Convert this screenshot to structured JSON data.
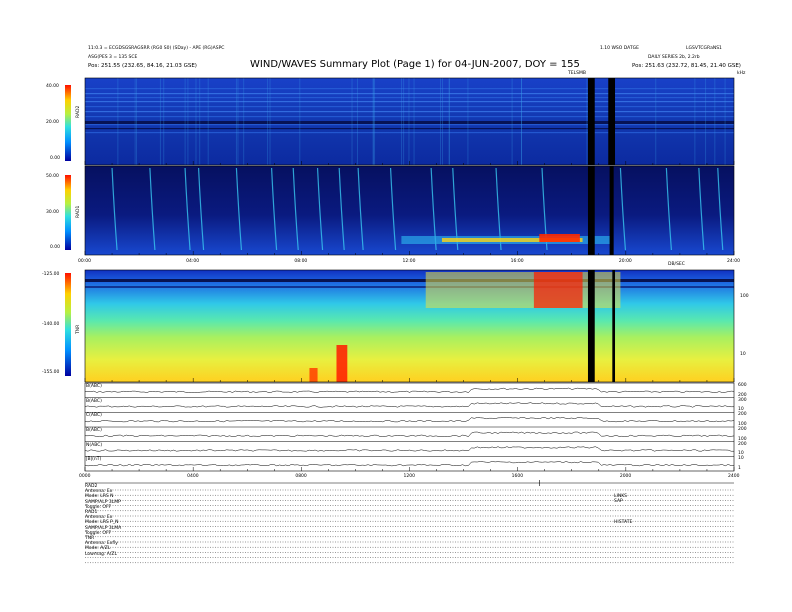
{
  "header": {
    "title": "WIND/WAVES Summary Plot (Page 1) for 04-JUN-2007, DOY = 155",
    "left_line1": "11:0.3 = ECGDSGSRAGSRR (RG0 S0) (SDay) - APE (RG)ASPC",
    "left_line2": "ASG(PES 3 = 135 SCE",
    "left_line3": "Pos:   251.55 (232.65, 84.16, 21.03 GSE)",
    "right_line1": "1.10 WSO DATGE",
    "right_line2": "LGSVTCGRaNS1",
    "right_line3": "DAILY SERIES 2b, 2.2rb",
    "right_line4": "Pos:   251.63 (232.72, 81.45, 21.40 GSE)",
    "marker_tnr": "TELSMB",
    "marker_top_right": "kHz"
  },
  "chart_data": [
    {
      "type": "heatmap",
      "name": "RAD2",
      "ylabel": "RAD2",
      "colorbar_ticks": [
        "40.00",
        "20.00",
        "0.00"
      ],
      "x_range_hours": [
        0,
        24
      ],
      "data_gaps_hours": [
        [
          18.6,
          18.85
        ],
        [
          19.35,
          19.6
        ]
      ]
    },
    {
      "type": "heatmap",
      "name": "RAD1",
      "ylabel": "RAD1",
      "colorbar_ticks": [
        "50.00",
        "30.00",
        "0.00"
      ],
      "x_range_hours": [
        0,
        24
      ],
      "x_tick_labels": [
        "00:00",
        "04:00",
        "08:00",
        "12:00",
        "16:00",
        "20:00",
        "24:00"
      ],
      "annotation": "DB/SEC",
      "data_gaps_hours": [
        [
          18.6,
          18.85
        ],
        [
          19.4,
          19.55
        ]
      ]
    },
    {
      "type": "heatmap",
      "name": "TNR",
      "ylabel": "TNR",
      "colorbar_ticks": [
        "-125.00",
        "-140.00",
        "-155.00"
      ],
      "right_axis_ticks": [
        "100",
        "10"
      ],
      "x_range_hours": [
        0,
        24
      ],
      "data_gaps_hours": [
        [
          18.6,
          18.85
        ],
        [
          19.5,
          19.6
        ]
      ]
    },
    {
      "type": "line",
      "name": "magnetometer traces",
      "traces": [
        {
          "label": "B(ABC)",
          "right_ticks": [
            "600",
            "200"
          ]
        },
        {
          "label": "B(ABC)",
          "right_ticks": [
            "300",
            "10"
          ]
        },
        {
          "label": "C(ABC)",
          "right_ticks": [
            "200",
            "100"
          ]
        },
        {
          "label": "B(ABC)",
          "right_ticks": [
            "200",
            "100"
          ]
        },
        {
          "label": "N(ABC)",
          "right_ticks": [
            "200",
            "10"
          ]
        },
        {
          "label": "|B|(nT)",
          "right_ticks": [
            "10",
            "1"
          ]
        }
      ],
      "x_tick_labels": [
        "0000",
        "0400",
        "0800",
        "1200",
        "1600",
        "2000",
        "2400"
      ]
    }
  ],
  "footer": {
    "left_block": [
      "RAD2",
      "Antenna:  Ex",
      "Mode:   LRS N",
      "SAMP/ALP 3LMP",
      "Toggle:   OFF",
      "RAD1",
      "Antenna:  Ex",
      "Mode:   LRS P_N",
      "SAMP/ALP 3LMA",
      "Toggle:   OFF",
      "TNR",
      "Antenna: Exfly",
      "Mode:   A/ZL",
      "Lowmag:   A/ZL"
    ],
    "right_block": [
      "LINKS",
      "SAP",
      "HISTATE"
    ]
  },
  "colors": {
    "background": "#ffffff",
    "low": "#0a1a8c",
    "mid": "#28c8e6",
    "high": "#ff1a00",
    "gap": "#000000"
  }
}
